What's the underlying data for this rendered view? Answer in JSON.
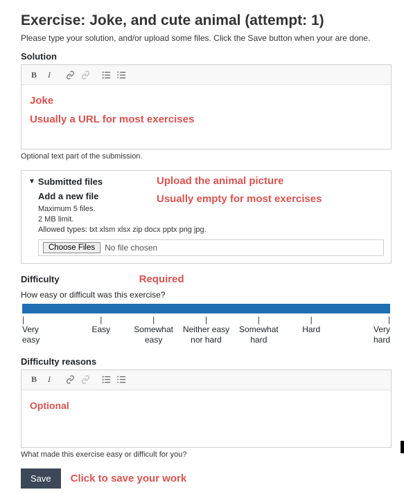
{
  "page": {
    "title": "Exercise: Joke, and cute animal (attempt: 1)",
    "instructions": "Please type your solution, and/or upload some files. Click the Save button when your are done."
  },
  "solution": {
    "label": "Solution",
    "annot_line1": "Joke",
    "annot_line2": "Usually a URL for most exercises",
    "help": "Optional text part of the submission."
  },
  "files": {
    "heading": "Submitted files",
    "annot_line1": "Upload the animal picture",
    "annot_line2": "Usually empty for most exercises",
    "add_label": "Add a new file",
    "constraint_max": "Maximum 5 files.",
    "constraint_size": "2 MB limit.",
    "constraint_types": "Allowed types: txt xlsm xlsx zip docx pptx png jpg.",
    "choose_btn": "Choose Files",
    "no_file": "No file chosen"
  },
  "difficulty": {
    "label": "Difficulty",
    "required_annot": "Required",
    "question": "How easy or difficult was this exercise?",
    "options": [
      "Very\neasy",
      "Easy",
      "Somewhat\neasy",
      "Neither easy\nnor hard",
      "Somewhat\nhard",
      "Hard",
      "Very\nhard"
    ]
  },
  "reasons": {
    "label": "Difficulty reasons",
    "annot": "Optional",
    "help": "What made this exercise easy or difficult for you?"
  },
  "save": {
    "button": "Save",
    "annot": "Click to save your work"
  },
  "toolbar_icons": {
    "bold": "B",
    "italic": "I",
    "link": "🔗",
    "unlink": "⛓",
    "ul": "≣",
    "ol": "≣"
  }
}
